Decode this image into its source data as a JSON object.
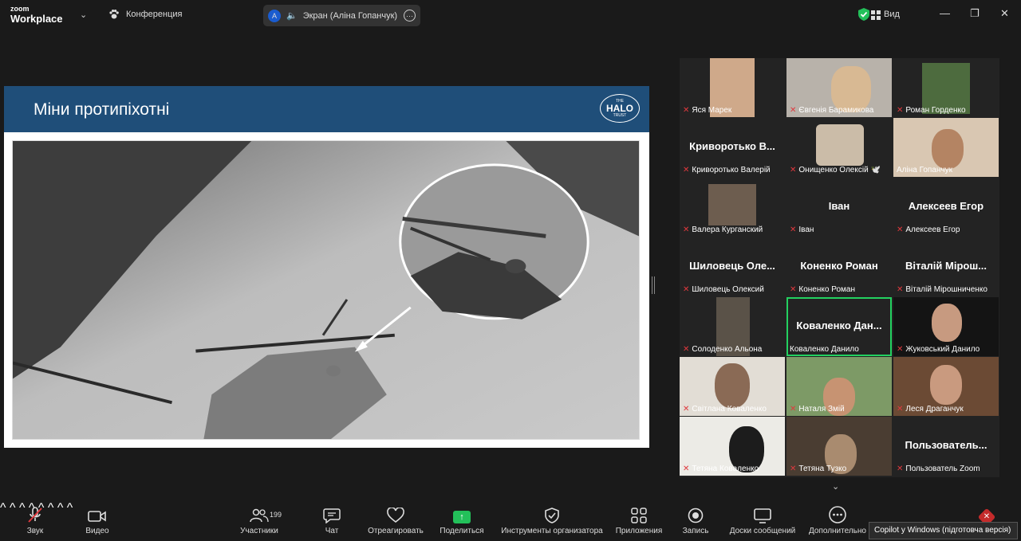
{
  "app": {
    "logo_top": "zoom",
    "logo_bottom": "Workplace",
    "meeting_name": "Конференция"
  },
  "screen_share": {
    "avatar_letter": "A",
    "label": "Экран (Аліна Гопанчук)"
  },
  "top_right": {
    "view_label": "Вид"
  },
  "slide": {
    "title": "Міни протипіхотні",
    "logo_top": "THE",
    "logo_main": "HALO",
    "logo_bottom": "TRUST"
  },
  "participants": [
    {
      "label": "Яся Марек",
      "muted": true
    },
    {
      "label": "Євгенія Барамикова",
      "muted": true
    },
    {
      "label": "Роман Горденко",
      "muted": true
    },
    {
      "big": "Криворотько В...",
      "label": "Криворотько Валерій",
      "muted": true
    },
    {
      "label": "Онищенко Олексій 🕊️",
      "muted": true
    },
    {
      "label": "Аліна Гопанчук",
      "muted": false
    },
    {
      "label": "Валера Курганский",
      "muted": true
    },
    {
      "big": "Іван",
      "label": "Іван",
      "muted": true
    },
    {
      "big": "Алексеев Егор",
      "label": "Алексеев Егор",
      "muted": true
    },
    {
      "big": "Шиловець Оле...",
      "label": "Шиловець Олексий",
      "muted": true
    },
    {
      "big": "Коненко Роман",
      "label": "Коненко Роман",
      "muted": true
    },
    {
      "big": "Віталій Мірош...",
      "label": "Віталій Мірошниченко",
      "muted": true
    },
    {
      "label": "Солоденко Альона",
      "muted": true
    },
    {
      "big": "Коваленко Дан...",
      "label": "Коваленко Данило",
      "muted": false
    },
    {
      "label": "Жуковський Данило",
      "muted": true
    },
    {
      "label": "Світлана Коваленко",
      "muted": true
    },
    {
      "label": "Наталя Змій",
      "muted": true
    },
    {
      "label": "Леся Драганчук",
      "muted": true
    },
    {
      "label": "Тетяна  Коваленко",
      "muted": true
    },
    {
      "label": "Тетяна Тузко",
      "muted": true
    },
    {
      "big": "Пользователь...",
      "label": "Пользователь Zoom",
      "muted": true
    }
  ],
  "toolbar": {
    "audio": "Звук",
    "video": "Видео",
    "participants": "Участники",
    "participants_count": "199",
    "chat": "Чат",
    "react": "Отреагировать",
    "share": "Поделиться",
    "host_tools": "Инструменты организатора",
    "apps": "Приложения",
    "record": "Запись",
    "whiteboards": "Доски сообщений",
    "more": "Дополнительно"
  },
  "copilot_tooltip": "Copilot у Windows (підготовча версія)",
  "colors": {
    "accent_green": "#23c05a",
    "slide_header": "#1f4e79",
    "mute_red": "#e0393e"
  }
}
